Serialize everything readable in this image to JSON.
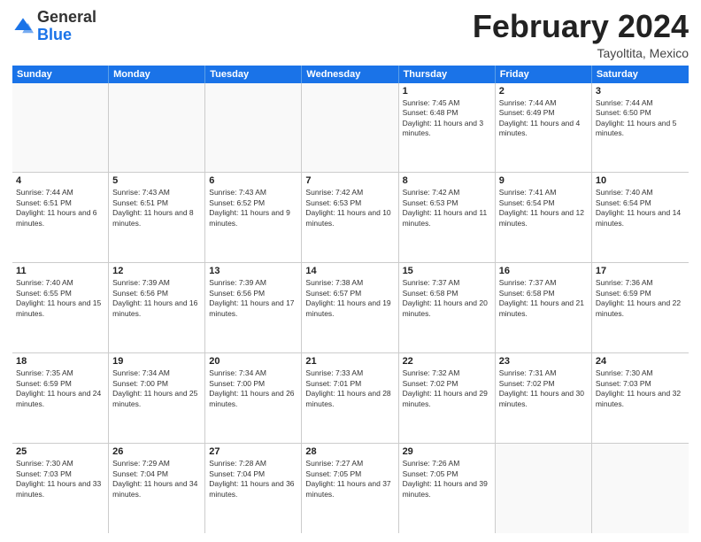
{
  "header": {
    "logo": {
      "general": "General",
      "blue": "Blue"
    },
    "title": "February 2024",
    "location": "Tayoltita, Mexico"
  },
  "days_of_week": [
    "Sunday",
    "Monday",
    "Tuesday",
    "Wednesday",
    "Thursday",
    "Friday",
    "Saturday"
  ],
  "rows": [
    [
      {
        "day": "",
        "text": ""
      },
      {
        "day": "",
        "text": ""
      },
      {
        "day": "",
        "text": ""
      },
      {
        "day": "",
        "text": ""
      },
      {
        "day": "1",
        "text": "Sunrise: 7:45 AM\nSunset: 6:48 PM\nDaylight: 11 hours and 3 minutes."
      },
      {
        "day": "2",
        "text": "Sunrise: 7:44 AM\nSunset: 6:49 PM\nDaylight: 11 hours and 4 minutes."
      },
      {
        "day": "3",
        "text": "Sunrise: 7:44 AM\nSunset: 6:50 PM\nDaylight: 11 hours and 5 minutes."
      }
    ],
    [
      {
        "day": "4",
        "text": "Sunrise: 7:44 AM\nSunset: 6:51 PM\nDaylight: 11 hours and 6 minutes."
      },
      {
        "day": "5",
        "text": "Sunrise: 7:43 AM\nSunset: 6:51 PM\nDaylight: 11 hours and 8 minutes."
      },
      {
        "day": "6",
        "text": "Sunrise: 7:43 AM\nSunset: 6:52 PM\nDaylight: 11 hours and 9 minutes."
      },
      {
        "day": "7",
        "text": "Sunrise: 7:42 AM\nSunset: 6:53 PM\nDaylight: 11 hours and 10 minutes."
      },
      {
        "day": "8",
        "text": "Sunrise: 7:42 AM\nSunset: 6:53 PM\nDaylight: 11 hours and 11 minutes."
      },
      {
        "day": "9",
        "text": "Sunrise: 7:41 AM\nSunset: 6:54 PM\nDaylight: 11 hours and 12 minutes."
      },
      {
        "day": "10",
        "text": "Sunrise: 7:40 AM\nSunset: 6:54 PM\nDaylight: 11 hours and 14 minutes."
      }
    ],
    [
      {
        "day": "11",
        "text": "Sunrise: 7:40 AM\nSunset: 6:55 PM\nDaylight: 11 hours and 15 minutes."
      },
      {
        "day": "12",
        "text": "Sunrise: 7:39 AM\nSunset: 6:56 PM\nDaylight: 11 hours and 16 minutes."
      },
      {
        "day": "13",
        "text": "Sunrise: 7:39 AM\nSunset: 6:56 PM\nDaylight: 11 hours and 17 minutes."
      },
      {
        "day": "14",
        "text": "Sunrise: 7:38 AM\nSunset: 6:57 PM\nDaylight: 11 hours and 19 minutes."
      },
      {
        "day": "15",
        "text": "Sunrise: 7:37 AM\nSunset: 6:58 PM\nDaylight: 11 hours and 20 minutes."
      },
      {
        "day": "16",
        "text": "Sunrise: 7:37 AM\nSunset: 6:58 PM\nDaylight: 11 hours and 21 minutes."
      },
      {
        "day": "17",
        "text": "Sunrise: 7:36 AM\nSunset: 6:59 PM\nDaylight: 11 hours and 22 minutes."
      }
    ],
    [
      {
        "day": "18",
        "text": "Sunrise: 7:35 AM\nSunset: 6:59 PM\nDaylight: 11 hours and 24 minutes."
      },
      {
        "day": "19",
        "text": "Sunrise: 7:34 AM\nSunset: 7:00 PM\nDaylight: 11 hours and 25 minutes."
      },
      {
        "day": "20",
        "text": "Sunrise: 7:34 AM\nSunset: 7:00 PM\nDaylight: 11 hours and 26 minutes."
      },
      {
        "day": "21",
        "text": "Sunrise: 7:33 AM\nSunset: 7:01 PM\nDaylight: 11 hours and 28 minutes."
      },
      {
        "day": "22",
        "text": "Sunrise: 7:32 AM\nSunset: 7:02 PM\nDaylight: 11 hours and 29 minutes."
      },
      {
        "day": "23",
        "text": "Sunrise: 7:31 AM\nSunset: 7:02 PM\nDaylight: 11 hours and 30 minutes."
      },
      {
        "day": "24",
        "text": "Sunrise: 7:30 AM\nSunset: 7:03 PM\nDaylight: 11 hours and 32 minutes."
      }
    ],
    [
      {
        "day": "25",
        "text": "Sunrise: 7:30 AM\nSunset: 7:03 PM\nDaylight: 11 hours and 33 minutes."
      },
      {
        "day": "26",
        "text": "Sunrise: 7:29 AM\nSunset: 7:04 PM\nDaylight: 11 hours and 34 minutes."
      },
      {
        "day": "27",
        "text": "Sunrise: 7:28 AM\nSunset: 7:04 PM\nDaylight: 11 hours and 36 minutes."
      },
      {
        "day": "28",
        "text": "Sunrise: 7:27 AM\nSunset: 7:05 PM\nDaylight: 11 hours and 37 minutes."
      },
      {
        "day": "29",
        "text": "Sunrise: 7:26 AM\nSunset: 7:05 PM\nDaylight: 11 hours and 39 minutes."
      },
      {
        "day": "",
        "text": ""
      },
      {
        "day": "",
        "text": ""
      }
    ]
  ]
}
